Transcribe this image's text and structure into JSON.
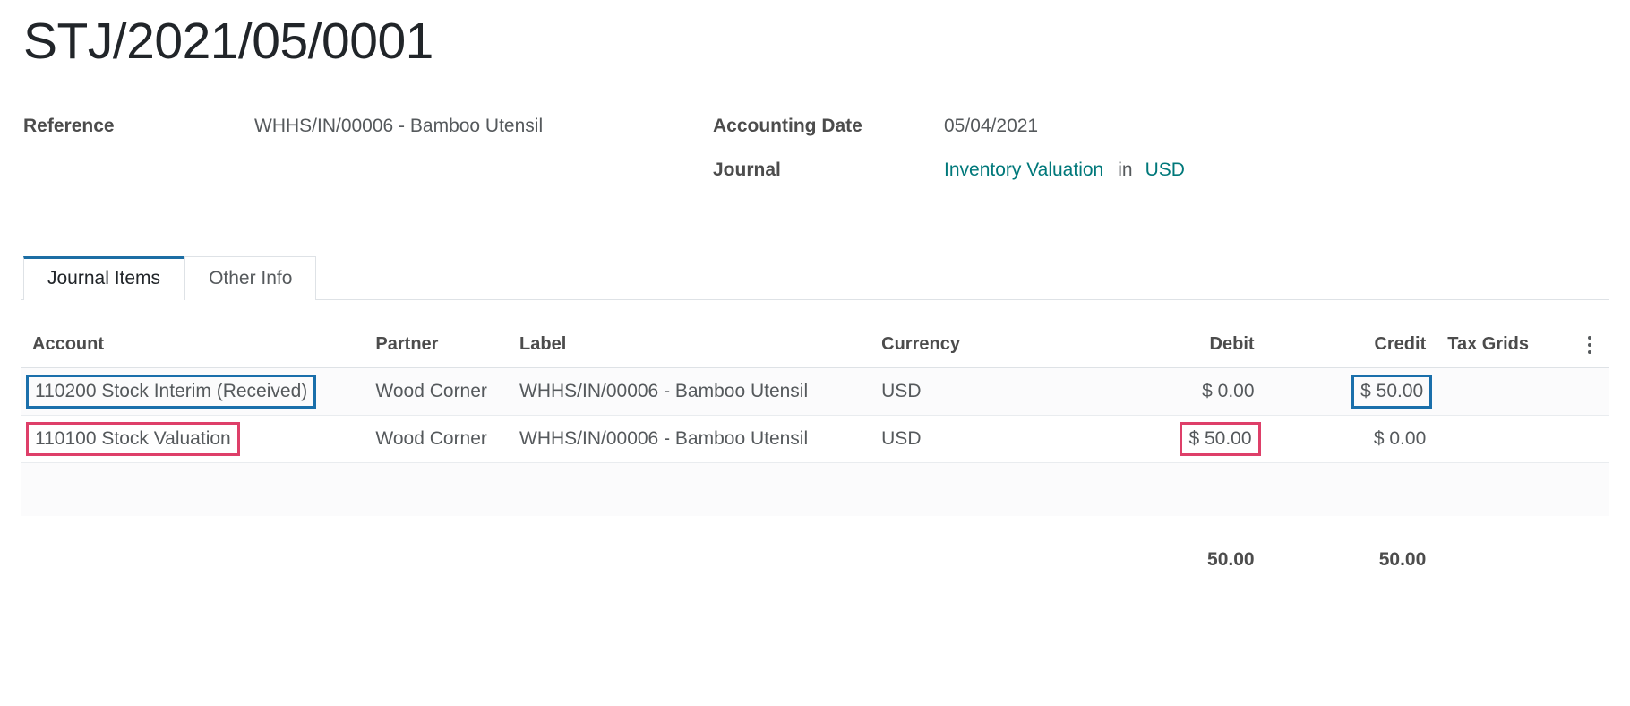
{
  "document": {
    "title": "STJ/2021/05/0001"
  },
  "header": {
    "left_fields": [
      {
        "label": "Reference",
        "value": "WHHS/IN/00006 - Bamboo Utensil"
      }
    ],
    "right_fields": {
      "accounting_date_label": "Accounting Date",
      "accounting_date_value": "05/04/2021",
      "journal_label": "Journal",
      "journal_value": "Inventory Valuation",
      "in_word": "in",
      "currency_value": "USD"
    }
  },
  "tabs": [
    {
      "label": "Journal Items",
      "active": true
    },
    {
      "label": "Other Info",
      "active": false
    }
  ],
  "table": {
    "columns": {
      "account": "Account",
      "partner": "Partner",
      "label": "Label",
      "currency": "Currency",
      "debit": "Debit",
      "credit": "Credit",
      "tax_grids": "Tax Grids",
      "options_icon": "vertical-dots-icon"
    },
    "rows": [
      {
        "account": "110200 Stock Interim (Received)",
        "partner": "Wood Corner",
        "label": "WHHS/IN/00006 - Bamboo Utensil",
        "currency": "USD",
        "debit": "$ 0.00",
        "credit": "$ 50.00",
        "tax_grids": ""
      },
      {
        "account": "110100 Stock Valuation",
        "partner": "Wood Corner",
        "label": "WHHS/IN/00006 - Bamboo Utensil",
        "currency": "USD",
        "debit": "$ 50.00",
        "credit": "$ 0.00",
        "tax_grids": ""
      }
    ],
    "totals": {
      "debit": "50.00",
      "credit": "50.00"
    }
  },
  "annotations": {
    "blue_color": "#1a6fab",
    "pink_color": "#de3f69",
    "highlighted": [
      {
        "target": "row-1-account",
        "color": "blue"
      },
      {
        "target": "row-1-credit",
        "color": "blue"
      },
      {
        "target": "row-2-account",
        "color": "pink"
      },
      {
        "target": "row-2-debit",
        "color": "pink"
      }
    ]
  },
  "theme": {
    "link_color": "#00787a",
    "active_tab_border": "#1c6ea4"
  }
}
